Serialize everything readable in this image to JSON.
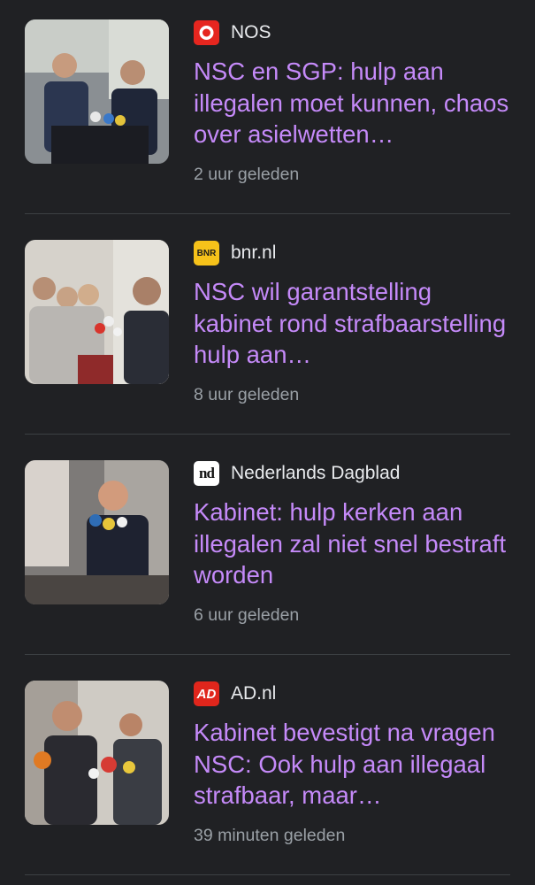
{
  "colors": {
    "background": "#202124",
    "headline": "#c58af9",
    "source_text": "#e8eaed",
    "time_text": "#9aa0a6",
    "divider": "#3c4043"
  },
  "articles": [
    {
      "source": "NOS",
      "logo_icon": "nos-logo-icon",
      "headline": "NSC en SGP: hulp aan illegalen moet kunnen, chaos over asielwetten…",
      "time": "2 uur geleden",
      "thumbnail": "press-conference-photo"
    },
    {
      "source": "bnr.nl",
      "logo_icon": "bnr-logo-icon",
      "logo_text": "BNR",
      "headline": "NSC wil garantstelling kabinet rond strafbaarstelling hulp aan…",
      "time": "8 uur geleden",
      "thumbnail": "press-interview-photo"
    },
    {
      "source": "Nederlands Dagblad",
      "logo_icon": "nd-logo-icon",
      "logo_text": "nd",
      "headline": "Kabinet: hulp kerken aan illegalen zal niet snel bestraft worden",
      "time": "6 uur geleden",
      "thumbnail": "politician-microphones-photo"
    },
    {
      "source": "AD.nl",
      "logo_icon": "ad-logo-icon",
      "logo_text": "AD",
      "headline": "Kabinet bevestigt na vragen NSC: Ook hulp aan illegaal strafbaar, maar…",
      "time": "39 minuten geleden",
      "thumbnail": "politician-press-photo"
    }
  ]
}
